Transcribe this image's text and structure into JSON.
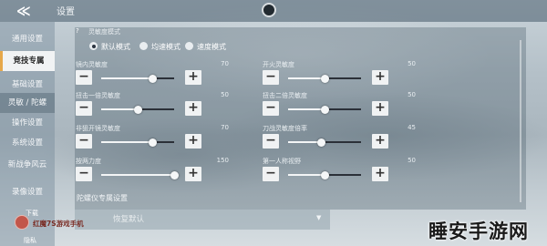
{
  "header": {
    "title": "设置",
    "back_icon": "back-chevron-icon"
  },
  "sidebar": {
    "items": [
      {
        "label": "通用设置"
      },
      {
        "label": "竞技专属",
        "active": true
      },
      {
        "label": "基础设置"
      },
      {
        "label": "灵敏 / 陀螺",
        "sub": true
      },
      {
        "label": "操作设置"
      },
      {
        "label": "系统设置"
      },
      {
        "label": "新战争风云"
      },
      {
        "label": "录像设置"
      }
    ],
    "extra_top": "下载",
    "extra_bottom": "隐私"
  },
  "sensitivity": {
    "section_title": "灵敏度模式",
    "help_icon": "question-icon",
    "modes": [
      {
        "label": "默认模式",
        "selected": true
      },
      {
        "label": "均速模式",
        "selected": false
      },
      {
        "label": "速度模式",
        "selected": false
      }
    ],
    "sliders": [
      {
        "label": "镜内灵敏度",
        "value": "70",
        "fraction": 0.7
      },
      {
        "label": "开火灵敏度",
        "value": "50",
        "fraction": 0.5
      },
      {
        "label": "扭击一倍灵敏度",
        "value": "50",
        "fraction": 0.5
      },
      {
        "label": "扭击二倍灵敏度",
        "value": "50",
        "fraction": 0.5
      },
      {
        "label": "非狙开镜灵敏度",
        "value": "70",
        "fraction": 0.7
      },
      {
        "label": "刀战灵敏度倍率",
        "value": "45",
        "fraction": 0.45
      },
      {
        "label": "按两力度",
        "value": "150",
        "fraction": 1.0
      },
      {
        "label": "第一人称视野",
        "value": "50",
        "fraction": 0.5
      }
    ],
    "minus_label": "−",
    "plus_label": "+"
  },
  "gyro": {
    "section_title": "陀螺仪专属设置"
  },
  "reset": {
    "label": "恢复默认",
    "chevron_icon": "chevron-down-icon"
  },
  "watermarks": {
    "left_text": "红魔7S游戏手机",
    "right_text": "睡安手游网"
  },
  "colors": {
    "active_accent": "#e6a84a",
    "track": "#2b3038",
    "fill": "#f3f5f6"
  }
}
